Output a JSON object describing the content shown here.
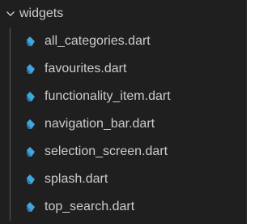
{
  "explorer": {
    "folder": {
      "name": "widgets",
      "expanded": true,
      "icon": "chevron-down-icon"
    },
    "files": [
      {
        "name": "all_categories.dart",
        "icon": "dart-file-icon"
      },
      {
        "name": "favourites.dart",
        "icon": "dart-file-icon"
      },
      {
        "name": "functionality_item.dart",
        "icon": "dart-file-icon"
      },
      {
        "name": "navigation_bar.dart",
        "icon": "dart-file-icon"
      },
      {
        "name": "selection_screen.dart",
        "icon": "dart-file-icon"
      },
      {
        "name": "splash.dart",
        "icon": "dart-file-icon"
      },
      {
        "name": "top_search.dart",
        "icon": "dart-file-icon"
      }
    ],
    "colors": {
      "background": "#1f1f1f",
      "text": "#cccccc",
      "dart_icon": "#41a6e0",
      "indent_guide": "#585858"
    }
  }
}
